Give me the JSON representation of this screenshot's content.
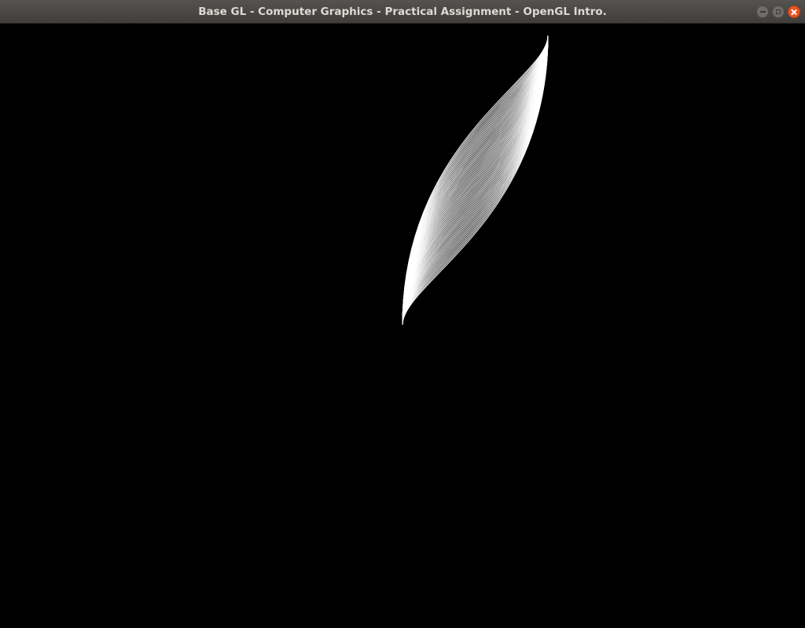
{
  "window": {
    "title": "Base GL - Computer Graphics - Practical Assignment - OpenGL Intro.",
    "controls": {
      "minimize_icon": "minimize-icon",
      "maximize_icon": "maximize-icon",
      "close_icon": "close-icon"
    }
  },
  "canvas": {
    "background_color": "#000000",
    "stroke_color": "#ffffff",
    "curve_count": 55
  }
}
